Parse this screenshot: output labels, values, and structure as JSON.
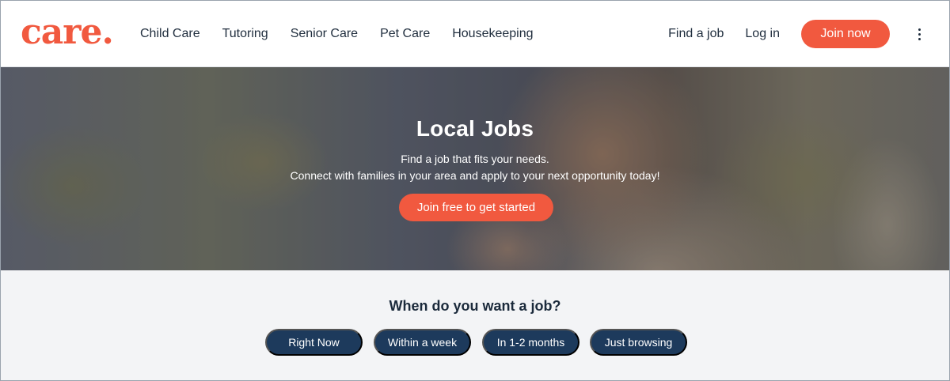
{
  "header": {
    "logo_text": "care.",
    "nav": [
      "Child Care",
      "Tutoring",
      "Senior Care",
      "Pet Care",
      "Housekeeping"
    ],
    "find_job": "Find a job",
    "log_in": "Log in",
    "join_now": "Join now",
    "more_icon": "kebab-menu-icon"
  },
  "hero": {
    "title": "Local Jobs",
    "line1": "Find a job that fits your needs.",
    "line2": "Connect with families in your area and apply to your next opportunity today!",
    "cta": "Join free to get started"
  },
  "question": {
    "title": "When do you want a job?",
    "options": [
      "Right Now",
      "Within a week",
      "In 1-2 months",
      "Just browsing"
    ]
  },
  "colors": {
    "brand": "#f1593f",
    "navy": "#1d3a5c",
    "text": "#1f2d3d",
    "section_bg": "#f3f4f6"
  }
}
